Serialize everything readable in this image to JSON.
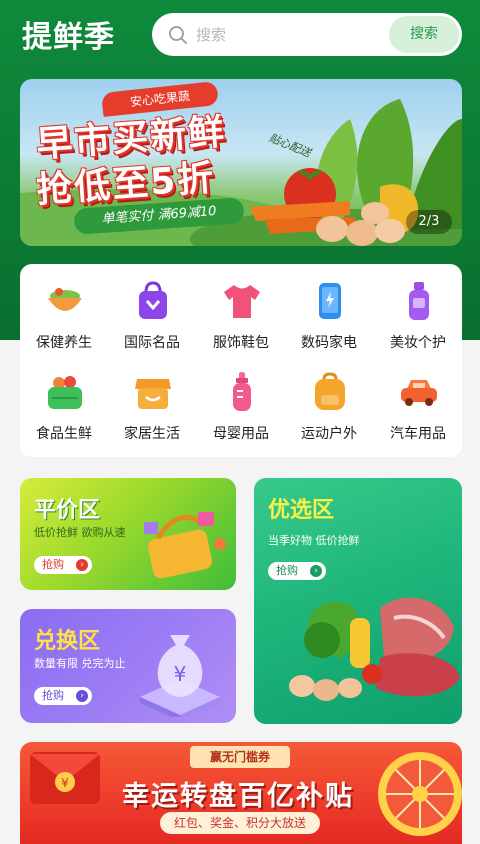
{
  "header": {
    "logo": "提鲜季",
    "search_placeholder": "搜索",
    "search_button": "搜索"
  },
  "banner": {
    "tag": "安心吃果蔬",
    "line1": "早市买新鲜",
    "line2": "抢低至5折",
    "sub": "单笔实付  满69减10",
    "handwrite": "贴心配送",
    "counter": "2/3"
  },
  "categories": [
    {
      "label": "保健养生",
      "icon": "bowl-icon"
    },
    {
      "label": "国际名品",
      "icon": "shopping-bag-icon"
    },
    {
      "label": "服饰鞋包",
      "icon": "tshirt-icon"
    },
    {
      "label": "数码家电",
      "icon": "phone-icon"
    },
    {
      "label": "美妆个护",
      "icon": "lotion-bottle-icon"
    },
    {
      "label": "食品生鲜",
      "icon": "basket-icon"
    },
    {
      "label": "家居生活",
      "icon": "store-icon"
    },
    {
      "label": "母婴用品",
      "icon": "baby-bottle-icon"
    },
    {
      "label": "运动户外",
      "icon": "backpack-icon"
    },
    {
      "label": "汽车用品",
      "icon": "car-icon"
    }
  ],
  "promos": {
    "pingjia": {
      "title": "平价区",
      "sub": "低价抢鲜 欲购从速",
      "button": "抢购"
    },
    "youxuan": {
      "title": "优选区",
      "sub": "当季好物 低价抢鲜",
      "button": "抢购"
    },
    "duihuan": {
      "title": "兑换区",
      "sub": "数量有限 兑完为止",
      "button": "抢购"
    }
  },
  "bottom_banner": {
    "tag": "赢无门槛券",
    "title": "幸运转盘百亿补贴",
    "sub": "红包、奖金、积分大放送"
  },
  "colors": {
    "brand_green": "#0b7a34",
    "search_button_bg": "#d7f0d9",
    "promo_red": "#e63c2c"
  }
}
